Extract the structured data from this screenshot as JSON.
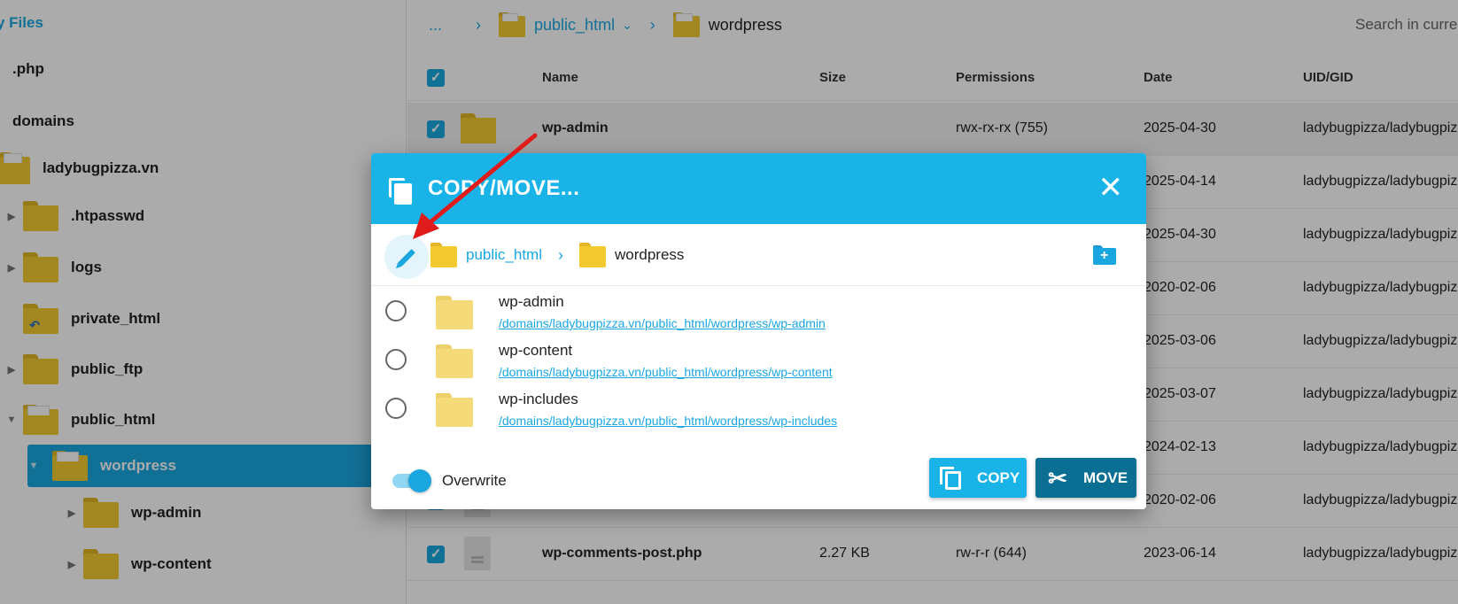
{
  "sidebar": {
    "title": "y Files",
    "items": [
      {
        "label": ".php"
      },
      {
        "label": "domains"
      },
      {
        "label": "ladybugpizza.vn"
      },
      {
        "label": ".htpasswd"
      },
      {
        "label": "logs"
      },
      {
        "label": "private_html"
      },
      {
        "label": "public_ftp"
      },
      {
        "label": "public_html"
      },
      {
        "label": "wordpress"
      },
      {
        "label": "wp-admin"
      },
      {
        "label": "wp-content"
      }
    ]
  },
  "breadcrumb": {
    "ellipsis": "...",
    "items": [
      {
        "label": "public_html"
      },
      {
        "label": "wordpress"
      }
    ]
  },
  "search": {
    "placeholder": "Search in curre"
  },
  "table": {
    "headers": {
      "name": "Name",
      "size": "Size",
      "permissions": "Permissions",
      "date": "Date",
      "uid": "UID/GID"
    },
    "rows": [
      {
        "name": "wp-admin",
        "size": "",
        "permissions": "rwx-rx-rx (755)",
        "date": "2025-04-30",
        "uid": "ladybugpizza/ladybugpiz"
      },
      {
        "name": "",
        "size": "",
        "permissions": "",
        "date": "2025-04-14",
        "uid": "ladybugpizza/ladybugpiz"
      },
      {
        "name": "",
        "size": "",
        "permissions": "",
        "date": "2025-04-30",
        "uid": "ladybugpizza/ladybugpiz"
      },
      {
        "name": "",
        "size": "",
        "permissions": "",
        "date": "2020-02-06",
        "uid": "ladybugpizza/ladybugpiz"
      },
      {
        "name": "",
        "size": "",
        "permissions": "",
        "date": "2025-03-06",
        "uid": "ladybugpizza/ladybugpiz"
      },
      {
        "name": "",
        "size": "",
        "permissions": "",
        "date": "2025-03-07",
        "uid": "ladybugpizza/ladybugpiz"
      },
      {
        "name": "",
        "size": "",
        "permissions": "",
        "date": "2024-02-13",
        "uid": "ladybugpizza/ladybugpiz"
      },
      {
        "name": "",
        "size": "",
        "permissions": "",
        "date": "2020-02-06",
        "uid": "ladybugpizza/ladybugpiz"
      },
      {
        "name": "wp-comments-post.php",
        "size": "2.27 KB",
        "permissions": "rw-r-r (644)",
        "date": "2023-06-14",
        "uid": "ladybugpizza/ladybugpiz"
      }
    ]
  },
  "dialog": {
    "title": "COPY/MOVE...",
    "close": "✕",
    "path": [
      {
        "label": "public_html"
      },
      {
        "label": "wordpress"
      }
    ],
    "folders": [
      {
        "name": "wp-admin",
        "path": "/domains/ladybugpizza.vn/public_html/wordpress/wp-admin"
      },
      {
        "name": "wp-content",
        "path": "/domains/ladybugpizza.vn/public_html/wordpress/wp-content"
      },
      {
        "name": "wp-includes",
        "path": "/domains/ladybugpizza.vn/public_html/wordpress/wp-includes"
      }
    ],
    "overwrite_label": "Overwrite",
    "overwrite_on": true,
    "copy_label": "COPY",
    "move_label": "MOVE"
  },
  "colors": {
    "accent": "#1ab3e8",
    "move_button": "#0b6e93",
    "folder": "#f3c931",
    "annotation_arrow": "#e01b1b"
  },
  "icons": {
    "dialog_title": "copy-icon",
    "edit": "pencil-icon",
    "new_folder": "new-folder-icon",
    "copy_button": "copy-icon",
    "move_button": "scissors-icon",
    "close": "close-icon"
  }
}
